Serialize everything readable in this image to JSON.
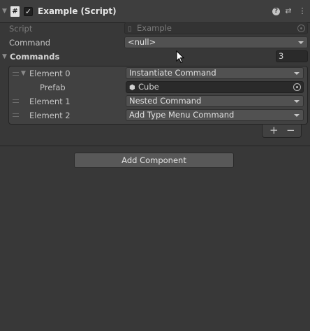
{
  "component": {
    "title": "Example (Script)",
    "enabled_check": "✓",
    "script_icon_glyph": "#",
    "icons": [
      "foldout-arrow-icon",
      "script-icon",
      "help-icon",
      "presets-icon",
      "kebab-menu-icon"
    ]
  },
  "fields": {
    "script_label": "Script",
    "script_value": "Example",
    "command_label": "Command",
    "command_value": "<null>"
  },
  "commands": {
    "label": "Commands",
    "size": "3",
    "elements": [
      {
        "label": "Element 0",
        "value": "Instantiate Command"
      },
      {
        "label": "Element 1",
        "value": "Nested Command"
      },
      {
        "label": "Element 2",
        "value": "Add Type Menu Command"
      }
    ],
    "prefab": {
      "label": "Prefab",
      "value": "Cube"
    },
    "add_symbol": "+",
    "remove_symbol": "−"
  },
  "add_component_label": "Add Component",
  "colors": {
    "background": "#383838",
    "header": "#3e3e3e",
    "field": "#2a2a2a",
    "dropdown": "#515151",
    "text": "#c4c4c4"
  }
}
